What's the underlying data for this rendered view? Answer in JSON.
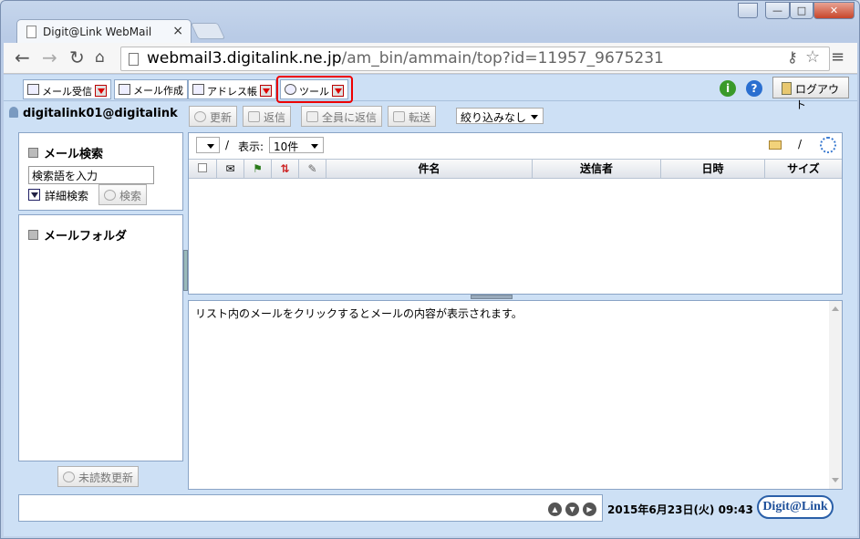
{
  "browser": {
    "tab_title": "Digit@Link WebMail",
    "tab_close": "×",
    "url_host": "webmail3.digitalink.ne.jp",
    "url_path": "/am_bin/ammain/top?id=11957_9675231",
    "win_min": "—",
    "win_max": "□",
    "win_close": "✕"
  },
  "app_tabs": {
    "mail_receive": "メール受信",
    "mail_compose": "メール作成",
    "address_book": "アドレス帳",
    "tools": "ツール",
    "logout": "ログアウト",
    "info_icon": "i",
    "help_icon": "?"
  },
  "account": "digitalink01@digitalink",
  "actions": {
    "refresh": "更新",
    "reply": "返信",
    "reply_all": "全員に返信",
    "forward": "転送",
    "filter": "絞り込みなし"
  },
  "search": {
    "title": "メール検索",
    "input_value": "検索語を入力",
    "advanced": "詳細検索",
    "button": "検索"
  },
  "folders": {
    "title": "メールフォルダ"
  },
  "unread_refresh": "未読数更新",
  "list": {
    "slash": "/",
    "display_label": "表示:",
    "per_page": "10件",
    "columns": [
      "件名",
      "送信者",
      "日時",
      "サイズ"
    ]
  },
  "preview": {
    "message": "リスト内のメールをクリックするとメールの内容が表示されます。"
  },
  "status": {
    "datetime": "2015年6月23日(火) 09:43",
    "logo": "Digit@Link"
  },
  "colors": {
    "page_bg": "#cde0f5",
    "highlight": "#ee0000",
    "info_green": "#3a9a2a",
    "help_blue": "#2a6fd0"
  }
}
